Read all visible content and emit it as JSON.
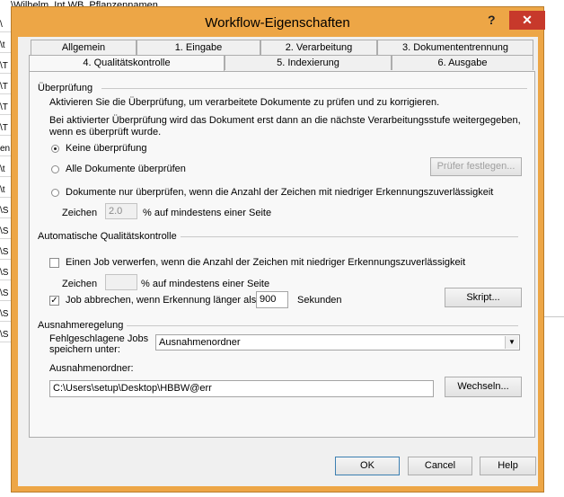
{
  "background": {
    "top_text": "\\Wilhelm_Int.WB_Pflanzennamen",
    "rows": [
      "\\",
      "\\t",
      "\\T",
      "\\T",
      "\\T",
      "\\T",
      "en",
      "\\t",
      "\\t",
      "\\S",
      "\\S",
      "\\S",
      "\\S",
      "\\S",
      "\\S",
      "\\S"
    ]
  },
  "window": {
    "title": "Workflow-Eigenschaften",
    "help_glyph": "?",
    "close_glyph": "✕"
  },
  "tabs_row1": [
    "Allgemein",
    "1. Eingabe",
    "2. Verarbeitung",
    "3. Dokumententrennung"
  ],
  "tabs_row2": [
    "4. Qualitätskontrolle",
    "5. Indexierung",
    "6. Ausgabe"
  ],
  "pruefung": {
    "group_label": "Überprüfung",
    "desc1": "Aktivieren Sie die Überprüfung, um verarbeitete Dokumente zu prüfen und zu korrigieren.",
    "desc2": "Bei aktivierter Überprüfung wird das Dokument erst dann an die nächste Verarbeitungsstufe weitergegeben,",
    "desc3": "wenn es überprüft wurde.",
    "radio1": "Keine überprüfung",
    "radio2": "Alle Dokumente überprüfen",
    "radio3": "Dokumente nur überprüfen, wenn die Anzahl der Zeichen mit niedriger Erkennungszuverlässigkeit",
    "pruefer_button": "Prüfer festlegen...",
    "zeichen_label": "Zeichen",
    "zeichen_value": "2.0",
    "percent_suffix": "%  auf mindestens einer Seite"
  },
  "auto": {
    "group_label": "Automatische Qualitätskontrolle",
    "check1": "Einen Job verwerfen, wenn die Anzahl der Zeichen mit niedriger Erkennungszuverlässigkeit",
    "zeichen_label": "Zeichen",
    "percent_suffix": "% auf mindestens einer Seite",
    "check2": "Job abbrechen, wenn Erkennung länger als",
    "seconds_value": "900",
    "seconds_label": "Sekunden",
    "script_button": "Skript..."
  },
  "ausnahme": {
    "group_label": "Ausnahmeregelung",
    "failed_label_1": "Fehlgeschlagene Jobs",
    "failed_label_2": "speichern unter:",
    "dropdown_value": "Ausnahmenordner",
    "folder_label": "Ausnahmenordner:",
    "folder_path": "C:\\Users\\setup\\Desktop\\HBBW@err",
    "change_button": "Wechseln..."
  },
  "footer": {
    "ok": "OK",
    "cancel": "Cancel",
    "help": "Help"
  },
  "colors": {
    "window_frame": "#eda646",
    "close_button": "#c7392b"
  }
}
